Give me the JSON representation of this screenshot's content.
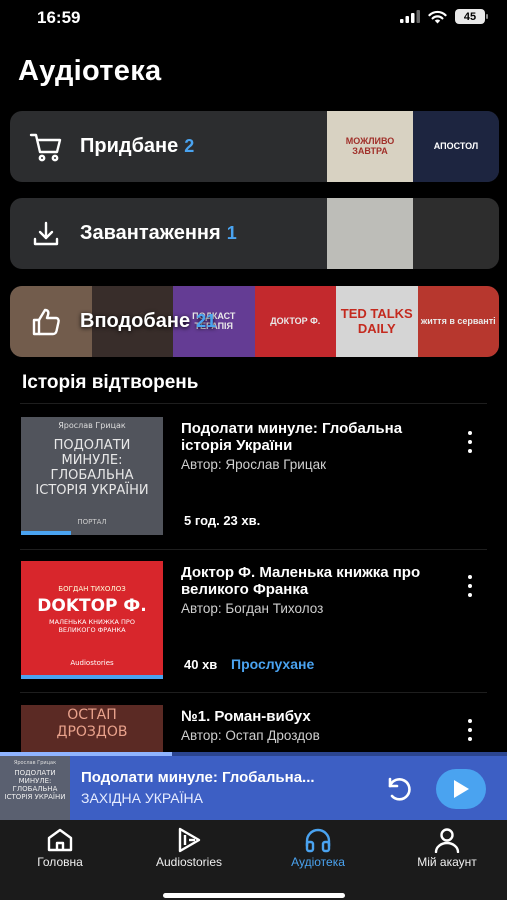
{
  "status_bar": {
    "time": "16:59",
    "battery": "45"
  },
  "page_title": "Аудіотека",
  "library": {
    "purchased": {
      "label": "Придбане",
      "count": "2",
      "icon": "cart-icon"
    },
    "downloads": {
      "label": "Завантаження",
      "count": "1",
      "icon": "download-icon"
    },
    "liked": {
      "label": "Вподобане",
      "count": "21",
      "icon": "thumbs-up-icon"
    }
  },
  "covers": {
    "purchased": [
      {
        "text": "МОЖЛИВО ЗАВТРА",
        "color": "#d8d2c2"
      },
      {
        "text": "АПОСТОЛ",
        "color": "#1d2540"
      }
    ],
    "downloads": [
      {
        "text": "",
        "color": "#bdbdb8"
      },
      {
        "text": "",
        "color": "#2d2d2d"
      }
    ],
    "liked": [
      {
        "text": "",
        "color": "#7a6250"
      },
      {
        "text": "",
        "color": "#3a2e2a"
      },
      {
        "text": "ПОДКАСТ ТЕРАПІЯ",
        "color": "#6b3fa0"
      },
      {
        "text": "ДОКТОР Ф.",
        "color": "#d42a2e"
      },
      {
        "text": "TED TALKS DAILY",
        "color": "#e8e8e8"
      },
      {
        "text": "життя в серванті",
        "color": "#c7392f"
      }
    ]
  },
  "history": {
    "title": "Історія відтворень",
    "items": [
      {
        "title": "Подолати минуле: Глобальна історія України",
        "author": "Автор: Ярослав Грицак",
        "duration": "5 год. 23 хв.",
        "status": "",
        "progress": 0.35,
        "art": {
          "author": "Ярослав Грицак",
          "title": "ПОДОЛАТИ МИНУЛЕ: ГЛОБАЛЬНА ІСТОРІЯ УКРАЇНИ",
          "publisher": "ПОРТАЛ",
          "bg": "#51545c"
        }
      },
      {
        "title": "Доктор Ф. Маленька книжка про великого Франка",
        "author": "Автор: Богдан Тихолоз",
        "duration": "40 хв",
        "status": "Прослухане",
        "progress": 1,
        "art": {
          "author": "БОГДАН ТИХОЛОЗ",
          "title": "DOKTOP Ф.",
          "subtitle": "МАЛЕНЬКА КНИЖКА ПРО ВЕЛИКОГО ФРАНКА",
          "publisher": "Audiostories",
          "bg": "#d8262c"
        }
      },
      {
        "title": "№1. Роман-вибух",
        "author": "Автор: Остап Дроздов",
        "duration": "",
        "status": "",
        "progress": 0,
        "art": {
          "title": "ОСТАП ДРОЗДОВ",
          "bg": "#5b2a24"
        }
      }
    ]
  },
  "mini_player": {
    "title": "Подолати минуле: Глобальна...",
    "subtitle": "ЗАХІДНА УКРАЇНА",
    "progress": 0.34,
    "thumb_author": "Ярослав Грицак",
    "thumb_title": "ПОДОЛАТИ МИНУЛЕ: ГЛОБАЛЬНА ІСТОРІЯ УКРАЇНИ"
  },
  "tabs": [
    {
      "label": "Головна",
      "icon": "home-icon",
      "active": false
    },
    {
      "label": "Audiostories",
      "icon": "audiostories-logo-icon",
      "active": false
    },
    {
      "label": "Аудіотека",
      "icon": "headphones-icon",
      "active": true
    },
    {
      "label": "Мій акаунт",
      "icon": "user-icon",
      "active": false
    }
  ],
  "colors": {
    "accent": "#4aa3f0",
    "card": "#2c2d2f",
    "player": "#3d5fc4",
    "background": "#000000"
  }
}
